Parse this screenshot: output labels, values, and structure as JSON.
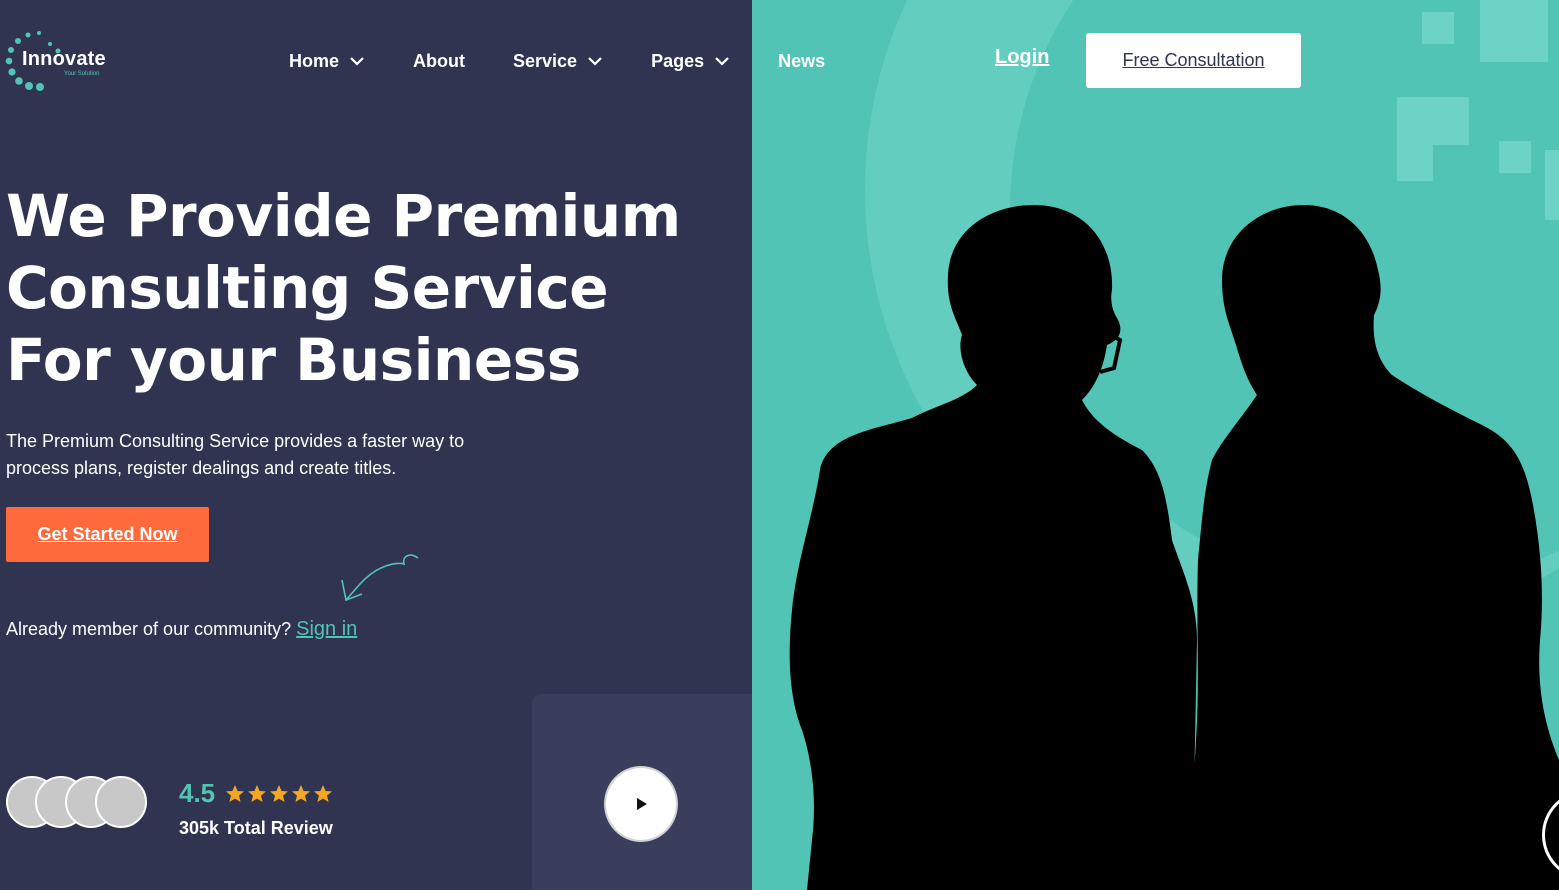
{
  "brand": {
    "name": "Innovate",
    "tagline": "Your Solution",
    "accent": "#51c4b6",
    "dark": "#313450",
    "orange": "#ff6a3d"
  },
  "nav": {
    "items": [
      {
        "label": "Home",
        "dropdown": true
      },
      {
        "label": "About",
        "dropdown": false
      },
      {
        "label": "Service",
        "dropdown": true
      },
      {
        "label": "Pages",
        "dropdown": true
      },
      {
        "label": "News",
        "dropdown": false
      }
    ],
    "login": "Login",
    "consult_button": "Free Consultation"
  },
  "hero": {
    "title_line1": "We Provide Premium",
    "title_line2": "Consulting Service",
    "title_line3": "For your Business",
    "subtitle": "The Premium Consulting Service provides a faster way to process plans, register dealings and create titles.",
    "cta": "Get Started Now",
    "member_text": "Already member of our community?",
    "signin": "Sign in"
  },
  "reviews": {
    "rating": "4.5",
    "stars": 5,
    "total": "305k Total Review"
  },
  "icons": {
    "chevron": "chevron-down-icon",
    "play": "play-icon",
    "star": "star-icon"
  }
}
